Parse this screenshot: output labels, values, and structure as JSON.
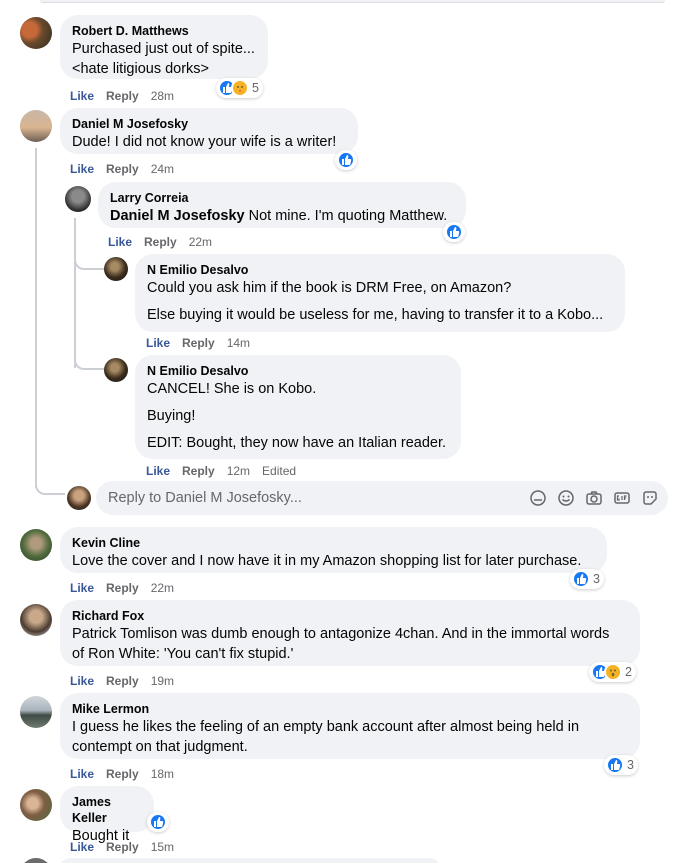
{
  "actions": {
    "like": "Like",
    "reply": "Reply",
    "edited": "Edited"
  },
  "comments": [
    {
      "author": "Robert D. Matthews",
      "lines": [
        "Purchased just out of spite...",
        "<hate litigious dorks>"
      ],
      "time": "28m",
      "reactions": "5"
    },
    {
      "author": "Daniel M Josefosky",
      "lines": [
        "Dude! I did not know your wife is a writer!"
      ],
      "time": "24m"
    },
    {
      "author": "Larry Correia",
      "mention": "Daniel M Josefosky",
      "text": " Not mine. I'm quoting Matthew.",
      "time": "22m"
    },
    {
      "author": "N Emilio Desalvo",
      "lines": [
        "Could you ask him if the book is DRM Free, on Amazon?",
        "Else buying it would be useless for me, having to transfer it to a Kobo..."
      ],
      "time": "14m"
    },
    {
      "author": "N Emilio Desalvo",
      "lines": [
        "CANCEL! She is on Kobo.",
        "Buying!",
        "EDIT: Bought, they now have an Italian reader."
      ],
      "time": "12m"
    },
    {
      "author": "Kevin Cline",
      "lines": [
        "Love the cover and I now have it in my Amazon shopping list for later purchase."
      ],
      "time": "22m",
      "reactions": "3"
    },
    {
      "author": "Richard Fox",
      "lines": [
        "Patrick Tomlison was dumb enough to antagonize 4chan. And in the immortal words",
        "of Ron White: 'You can't fix stupid.'"
      ],
      "time": "19m",
      "reactions": "2"
    },
    {
      "author": "Mike Lermon",
      "lines": [
        "I guess he likes the feeling of an empty bank account after almost being held in",
        "contempt on that judgment."
      ],
      "time": "18m",
      "reactions": "3"
    },
    {
      "author": "James Keller",
      "lines": [
        "Bought it"
      ],
      "time": "15m"
    }
  ],
  "reply_box": {
    "placeholder": "Reply to Daniel M Josefosky..."
  },
  "colors": {
    "link": "#385898",
    "meta": "#65676b",
    "bubble": "#f0f2f5",
    "like_blue": "#1877f2"
  }
}
